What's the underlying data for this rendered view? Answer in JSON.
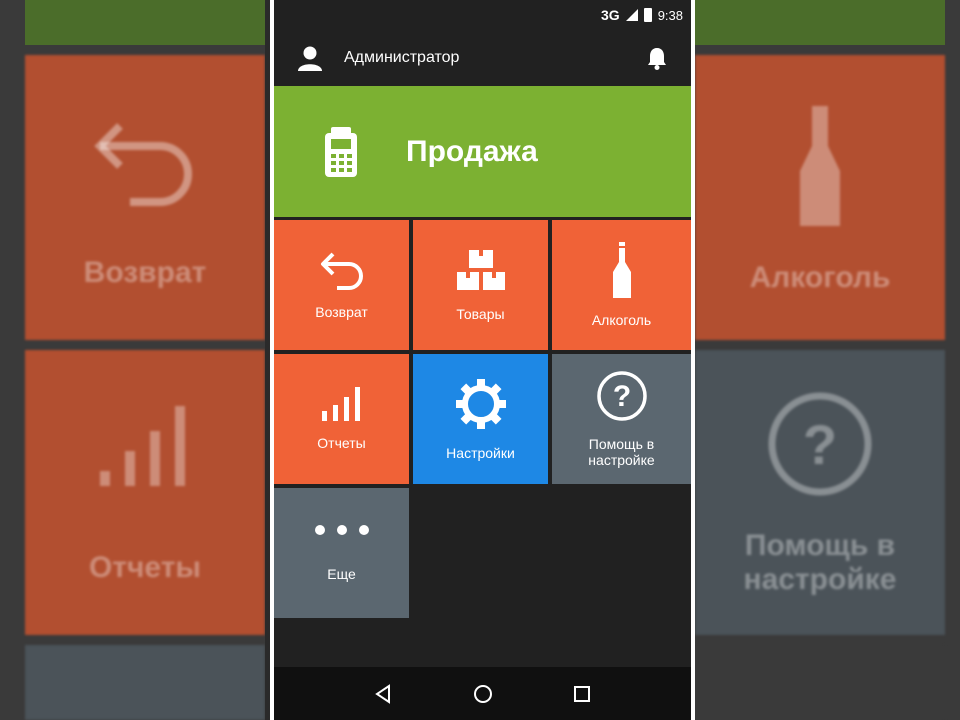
{
  "status_bar": {
    "network": "3G",
    "time": "9:38"
  },
  "app_bar": {
    "title": "Администратор"
  },
  "sale_tile": {
    "label": "Продажа"
  },
  "tiles": [
    {
      "label": "Возврат",
      "icon": "return-arrow-icon",
      "color": "#f06237"
    },
    {
      "label": "Товары",
      "icon": "boxes-icon",
      "color": "#f06237"
    },
    {
      "label": "Алкоголь",
      "icon": "bottle-icon",
      "color": "#f06237"
    },
    {
      "label": "Отчеты",
      "icon": "bar-chart-icon",
      "color": "#f06237"
    },
    {
      "label": "Настройки",
      "icon": "gear-icon",
      "color": "#1e88e5"
    },
    {
      "label": "Помощь в настройке",
      "icon": "help-circle-icon",
      "color": "#5b6770"
    },
    {
      "label": "Еще",
      "icon": "more-dots-icon",
      "color": "#5b6770"
    }
  ],
  "background_copy": {
    "left": [
      "Возврат",
      "Отчеты"
    ],
    "right": [
      "Алкоголь",
      "Помощь в настройке"
    ]
  },
  "colors": {
    "sale_green": "#7cb132",
    "tile_orange": "#f06237",
    "tile_blue": "#1e88e5",
    "tile_grey": "#5b6770"
  }
}
